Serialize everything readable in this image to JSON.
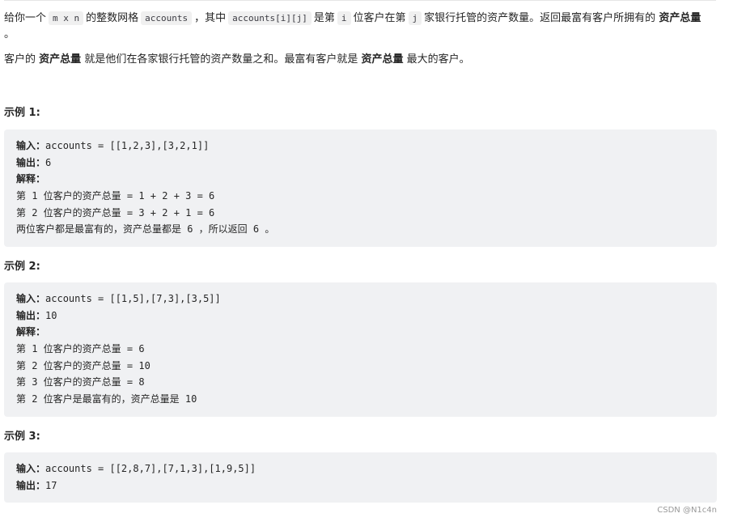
{
  "description": {
    "p1": {
      "t1": "给你一个",
      "c1": "m x n",
      "t2": "的整数网格",
      "c2": "accounts",
      "t3": "，其中",
      "c3": "accounts[i][j]",
      "t4": "是第",
      "c4": "i",
      "t5": "位客户在第",
      "c5": "j",
      "t6": "家银行托管的资产数量。返回最富有客户所拥有的",
      "b1": "资产总量",
      "t7": "。"
    },
    "p2": {
      "t1": "客户的",
      "b1": "资产总量",
      "t2": "就是他们在各家银行托管的资产数量之和。最富有客户就是",
      "b2": "资产总量",
      "t3": "最大的客户。"
    }
  },
  "examples": [
    {
      "heading": "示例 1:",
      "input_label": "输入：",
      "input": "accounts = [[1,2,3],[3,2,1]]",
      "output_label": "输出：",
      "output": "6",
      "explanation_label": "解释：",
      "explanation": [
        "第 1 位客户的资产总量 = 1 + 2 + 3 = 6",
        "第 2 位客户的资产总量 = 3 + 2 + 1 = 6",
        "两位客户都是最富有的，资产总量都是 6 ，所以返回 6 。"
      ]
    },
    {
      "heading": "示例 2:",
      "input_label": "输入：",
      "input": "accounts = [[1,5],[7,3],[3,5]]",
      "output_label": "输出：",
      "output": "10",
      "explanation_label": "解释：",
      "explanation": [
        "第 1 位客户的资产总量 = 6",
        "第 2 位客户的资产总量 = 10",
        "第 3 位客户的资产总量 = 8",
        "第 2 位客户是最富有的，资产总量是 10"
      ]
    },
    {
      "heading": "示例 3:",
      "input_label": "输入：",
      "input": "accounts = [[2,8,7],[7,1,3],[1,9,5]]",
      "output_label": "输出：",
      "output": "17"
    }
  ],
  "watermark": "CSDN @N1c4n"
}
